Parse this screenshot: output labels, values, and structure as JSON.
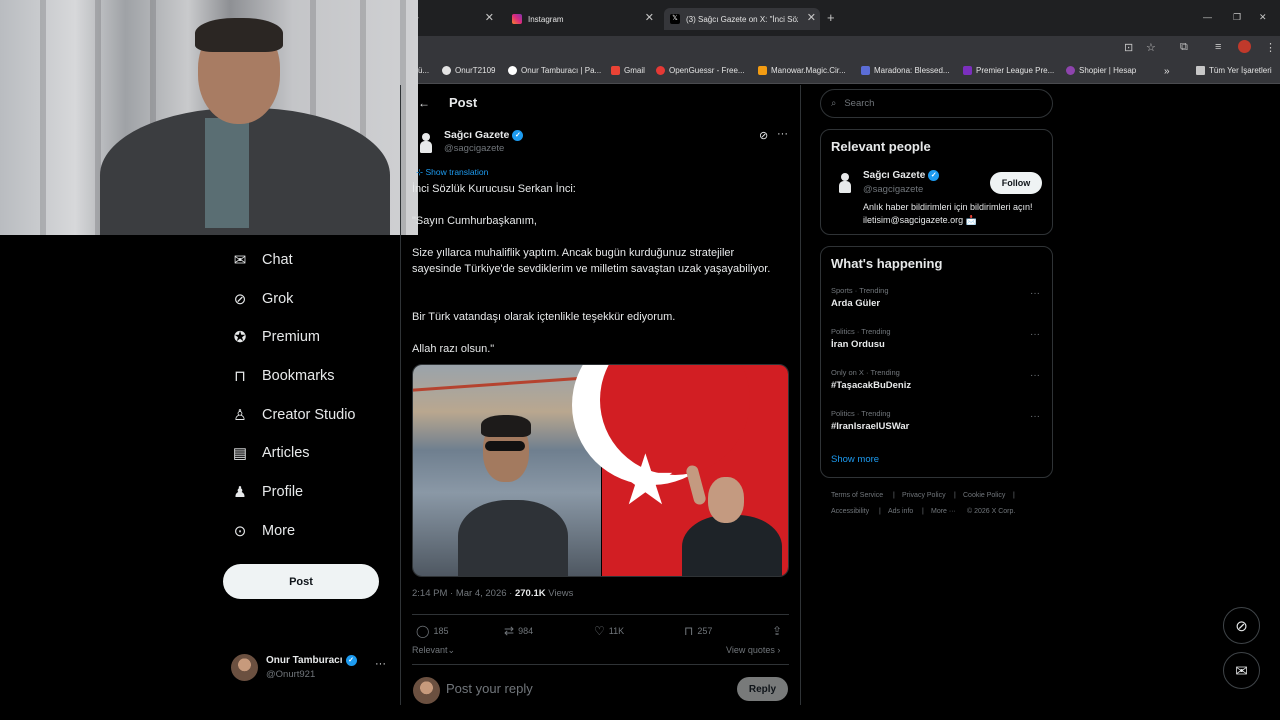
{
  "browser": {
    "tabs": [
      {
        "label": "r",
        "active": false
      },
      {
        "label": "Instagram",
        "active": false
      },
      {
        "label": "(3) Sağcı Gazete on X: \"İnci Sözlü",
        "active": true
      }
    ],
    "new_tab": "+",
    "bookmarks": [
      "ü...",
      "OnurT2109",
      "Onur Tamburacı | Pa...",
      "Gmail",
      "OpenGuessr - Free...",
      "Manowar.Magic.Cir...",
      "Maradona: Blessed...",
      "Premier League Pre...",
      "Shopier | Hesap",
      "»",
      "Tüm Yer İşaretleri"
    ]
  },
  "nav": {
    "items": [
      {
        "label": "Chat",
        "icon": "mail-icon"
      },
      {
        "label": "Grok",
        "icon": "grok-icon"
      },
      {
        "label": "Premium",
        "icon": "premium-icon"
      },
      {
        "label": "Bookmarks",
        "icon": "bookmark-icon"
      },
      {
        "label": "Creator Studio",
        "icon": "creator-icon"
      },
      {
        "label": "Articles",
        "icon": "articles-icon"
      },
      {
        "label": "Profile",
        "icon": "profile-icon"
      },
      {
        "label": "More",
        "icon": "more-icon"
      }
    ],
    "post_button": "Post",
    "account": {
      "name": "Onur Tamburacı",
      "handle": "@Onurt921",
      "more": "···"
    }
  },
  "post": {
    "header": "Post",
    "author": "Sağcı Gazete",
    "handle": "@sagcigazete",
    "show_translation": "Show translation",
    "paragraphs": [
      "İnci Sözlük Kurucusu Serkan İnci:",
      "\"Sayın Cumhurbaşkanım,",
      "Size yıllarca muhaliflik yaptım. Ancak bugün kurduğunuz stratejiler sayesinde Türkiye'de sevdiklerim ve milletim savaştan uzak yaşayabiliyor.",
      "Bir Türk vatandaşı olarak içtenlikle teşekkür ediyorum.",
      "Allah razı olsun.\""
    ],
    "time": "2:14 PM · Mar 4, 2026 · ",
    "views_count": "270.1K",
    "views_label": " Views",
    "replies": "185",
    "reposts": "984",
    "likes": "11K",
    "bookmarks": "257",
    "sort_label": "Relevant",
    "view_quotes": "View quotes",
    "reply_placeholder": "Post your reply",
    "reply_button": "Reply"
  },
  "sidebar": {
    "search_placeholder": "Search",
    "relevant_title": "Relevant people",
    "person": {
      "name": "Sağcı Gazete",
      "handle": "@sagcigazete",
      "bio": "Anlık haber bildirimleri için bildirimleri açın! iletisim@sagcigazete.org 📩",
      "follow": "Follow"
    },
    "happening_title": "What's happening",
    "trends": [
      {
        "category": "Sports · Trending",
        "name": "Arda Güler"
      },
      {
        "category": "Politics · Trending",
        "name": "İran Ordusu"
      },
      {
        "category": "Only on X · Trending",
        "name": "#TaşacakBuDeniz"
      },
      {
        "category": "Politics · Trending",
        "name": "#IranIsraelUSWar"
      }
    ],
    "show_more": "Show more",
    "footer": [
      "Terms of Service",
      "Privacy Policy",
      "Cookie Policy",
      "Accessibility",
      "Ads info",
      "More ···",
      "© 2026 X Corp."
    ]
  },
  "colors": {
    "accent": "#1d9bf0",
    "background": "#000000",
    "text": "#e7e9ea",
    "muted": "#71767b",
    "border": "#2f3336"
  }
}
